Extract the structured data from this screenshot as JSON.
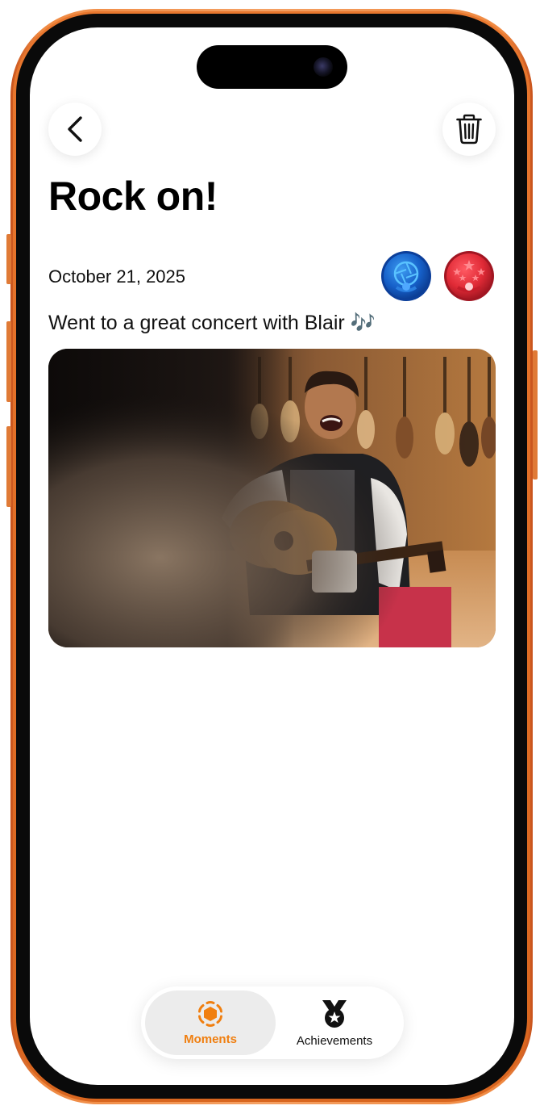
{
  "moment": {
    "title": "Rock on!",
    "date": "October 21, 2025",
    "description": "Went to a great concert with Blair 🎶"
  },
  "tabbar": {
    "tabs": [
      {
        "label": "Moments",
        "icon": "moments-icon",
        "selected": true
      },
      {
        "label": "Achievements",
        "icon": "medal-icon",
        "selected": false
      }
    ]
  },
  "colors": {
    "accent": "#f07f10",
    "frame": "#f08a42",
    "badge_blue": "#1c6fd6",
    "badge_red": "#e0303d"
  }
}
